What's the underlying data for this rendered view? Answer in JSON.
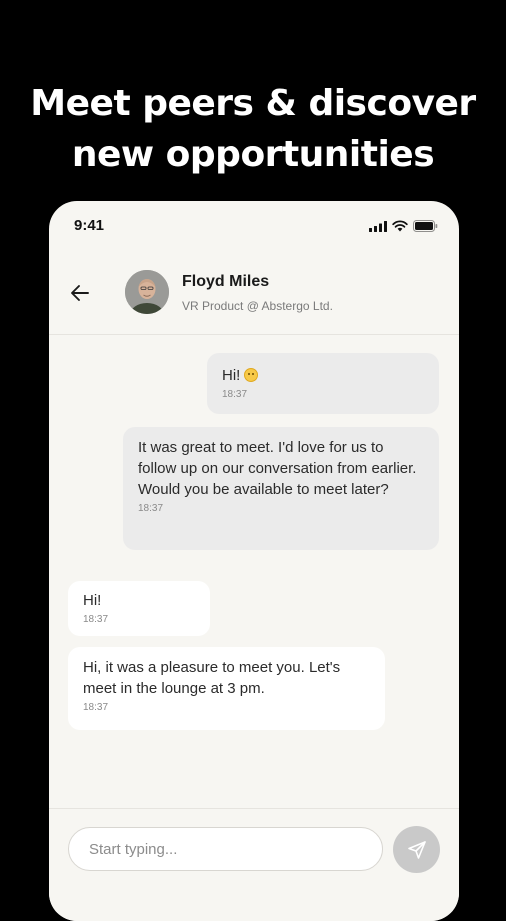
{
  "headline": {
    "line1": "Meet peers & discover",
    "line2": "new opportunities"
  },
  "status_bar": {
    "time": "9:41",
    "icons": [
      "signal-icon",
      "wifi-icon",
      "battery-icon"
    ]
  },
  "chat_header": {
    "back_icon": "back-arrow-icon",
    "contact_name": "Floyd Miles",
    "contact_role": "VR Product @ Abstergo Ltd."
  },
  "messages": [
    {
      "direction": "outgoing",
      "text": "Hi!",
      "emoji": "smiling-face-emoji",
      "time": "18:37"
    },
    {
      "direction": "outgoing",
      "text": "It was great to meet. I'd love for us to follow up on our conversation from earlier. Would you be available to meet later?",
      "time": "18:37"
    },
    {
      "direction": "incoming",
      "text": "Hi!",
      "time": "18:37"
    },
    {
      "direction": "incoming",
      "text": "Hi, it was a pleasure to meet you. Let's meet in the lounge at 3 pm.",
      "time": "18:37"
    }
  ],
  "composer": {
    "placeholder": "Start typing...",
    "send_icon": "send-icon"
  },
  "colors": {
    "background": "#000000",
    "phone_surface": "#f7f6f2",
    "outgoing_bubble": "#ebebeb",
    "incoming_bubble": "#ffffff",
    "send_button": "#c9c9c9"
  }
}
